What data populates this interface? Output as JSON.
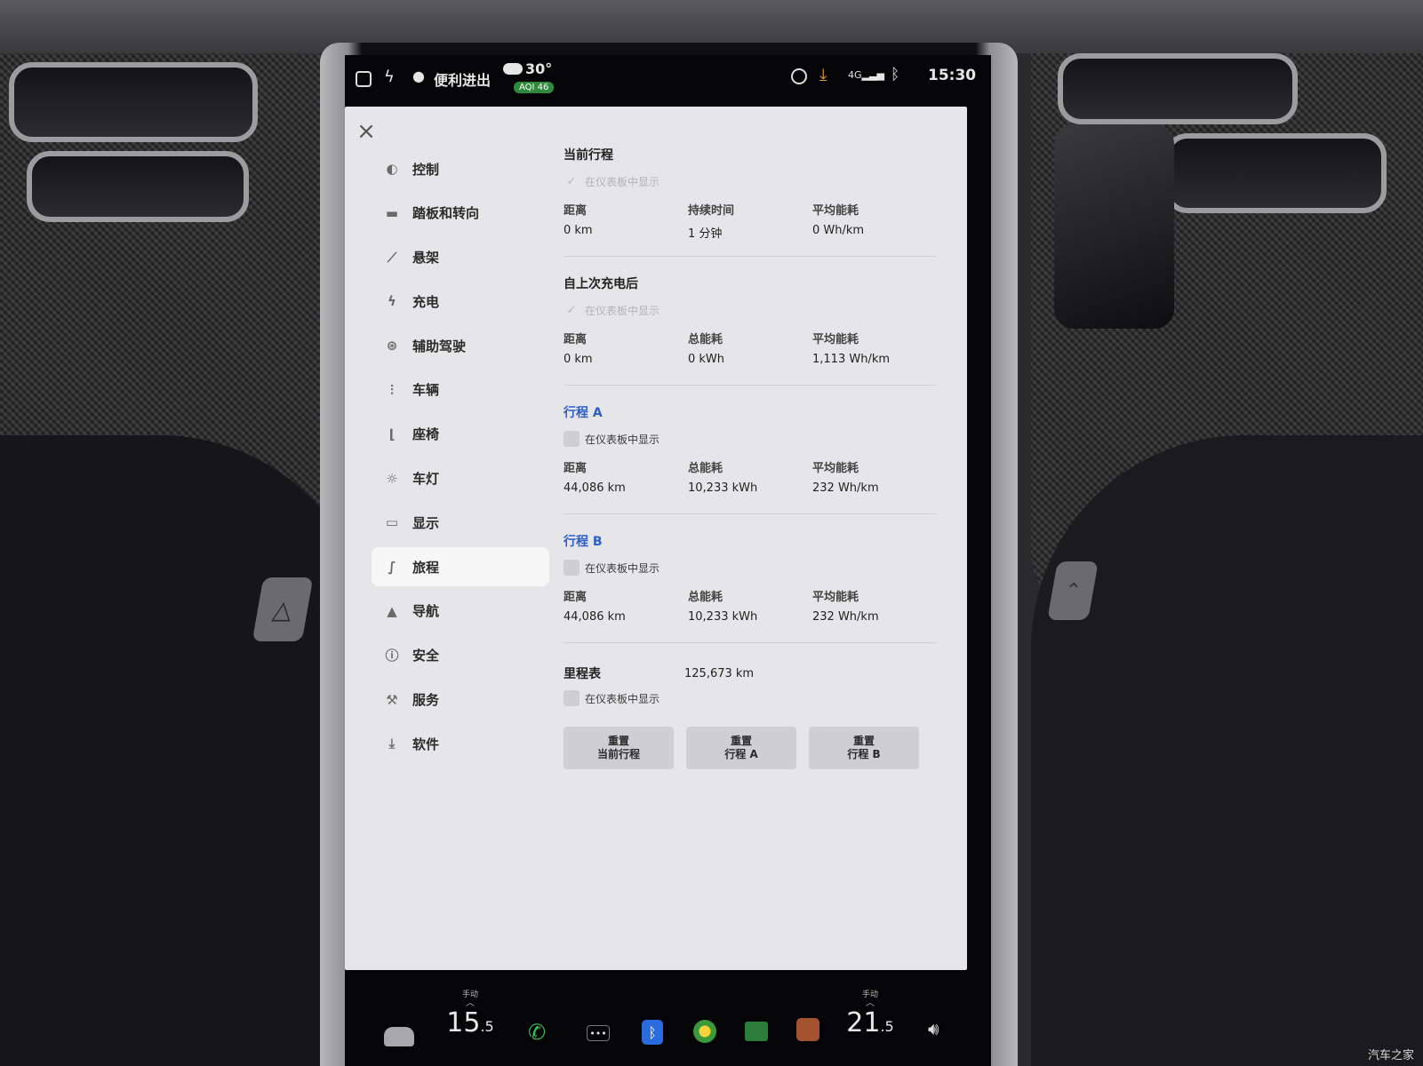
{
  "status_bar": {
    "profile": "便利进出",
    "temperature": "30°",
    "aqi": "AQI 46",
    "network": "4G",
    "time": "15:30"
  },
  "nav": {
    "items": [
      {
        "label": "控制",
        "icon": "toggle-icon"
      },
      {
        "label": "踏板和转向",
        "icon": "car-icon"
      },
      {
        "label": "悬架",
        "icon": "suspension-icon"
      },
      {
        "label": "充电",
        "icon": "bolt-icon"
      },
      {
        "label": "辅助驾驶",
        "icon": "steering-wheel-icon"
      },
      {
        "label": "车辆",
        "icon": "sliders-icon"
      },
      {
        "label": "座椅",
        "icon": "seat-icon"
      },
      {
        "label": "车灯",
        "icon": "light-icon"
      },
      {
        "label": "显示",
        "icon": "display-icon"
      },
      {
        "label": "旅程",
        "icon": "trip-icon"
      },
      {
        "label": "导航",
        "icon": "navigation-icon"
      },
      {
        "label": "安全",
        "icon": "safety-icon"
      },
      {
        "label": "服务",
        "icon": "wrench-icon"
      },
      {
        "label": "软件",
        "icon": "download-icon"
      }
    ],
    "active_index": 9
  },
  "checkbox_label": "在仪表板中显示",
  "current_trip": {
    "title": "当前行程",
    "labels": [
      "距离",
      "持续时间",
      "平均能耗"
    ],
    "values": [
      "0  km",
      "1 分钟",
      "0  Wh/km"
    ]
  },
  "since_charge": {
    "title": "自上次充电后",
    "labels": [
      "距离",
      "总能耗",
      "平均能耗"
    ],
    "values": [
      "0  km",
      "0  kWh",
      "1,113  Wh/km"
    ]
  },
  "trip_a": {
    "title": "行程 A",
    "labels": [
      "距离",
      "总能耗",
      "平均能耗"
    ],
    "values": [
      "44,086  km",
      "10,233  kWh",
      "232  Wh/km"
    ]
  },
  "trip_b": {
    "title": "行程 B",
    "labels": [
      "距离",
      "总能耗",
      "平均能耗"
    ],
    "values": [
      "44,086  km",
      "10,233  kWh",
      "232  Wh/km"
    ]
  },
  "odometer": {
    "label": "里程表",
    "value": "125,673  km"
  },
  "buttons": {
    "reset_current": [
      "重置",
      "当前行程"
    ],
    "reset_a": [
      "重置",
      "行程 A"
    ],
    "reset_b": [
      "重置",
      "行程 B"
    ]
  },
  "dock": {
    "left_mode": "手动",
    "left_temp_int": "15",
    "left_temp_dec": ".5",
    "right_mode": "手动",
    "right_temp_int": "21",
    "right_temp_dec": ".5"
  },
  "watermark": "汽车之家",
  "colors": {
    "accent_blue": "#2d5fc7",
    "aqi_green": "#2f8a3c",
    "download_orange": "#f0a030"
  }
}
